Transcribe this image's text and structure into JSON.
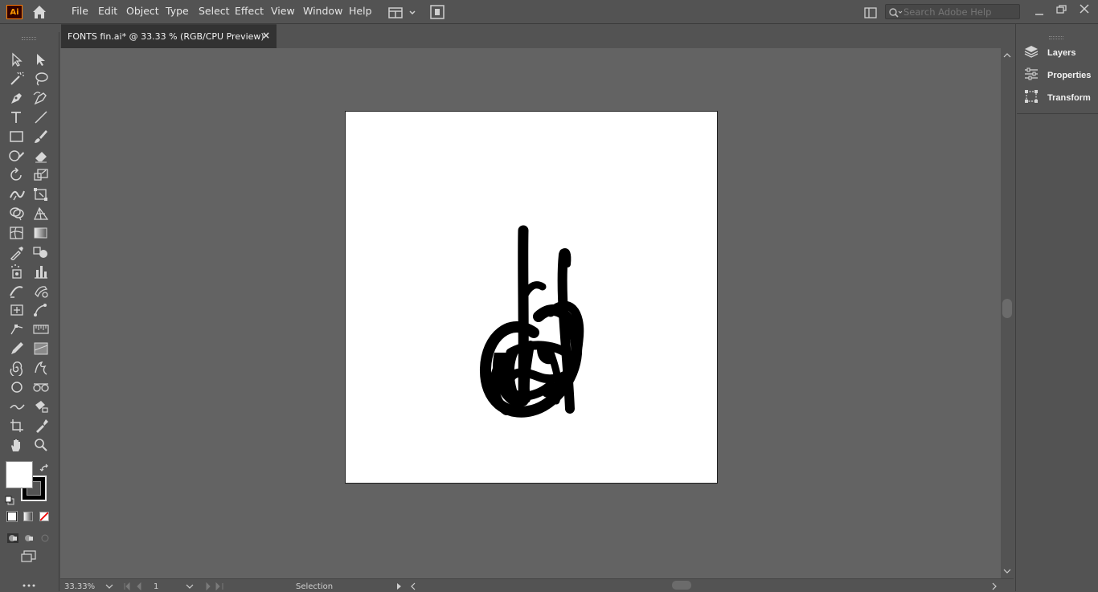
{
  "app": {
    "logo_text": "Ai",
    "menu": [
      "File",
      "Edit",
      "Object",
      "Type",
      "Select",
      "Effect",
      "View",
      "Window",
      "Help"
    ],
    "search_placeholder": "Search Adobe Help"
  },
  "document": {
    "tab_label": "FONTS fin.ai* @ 33.33 % (RGB/CPU Preview)",
    "close_glyph": "×"
  },
  "right_panel": {
    "items": [
      {
        "label": "Layers",
        "icon": "layers-icon"
      },
      {
        "label": "Properties",
        "icon": "properties-icon"
      },
      {
        "label": "Transform",
        "icon": "transform-icon"
      }
    ]
  },
  "status": {
    "zoom": "33.33%",
    "artboard_number": "1",
    "tool_name": "Selection"
  },
  "colors": {
    "accent_logo": "#ff9a00",
    "canvas_bg": "#636363",
    "ui_bg": "#535353",
    "artboard": "#ffffff",
    "artwork": "#000000"
  }
}
